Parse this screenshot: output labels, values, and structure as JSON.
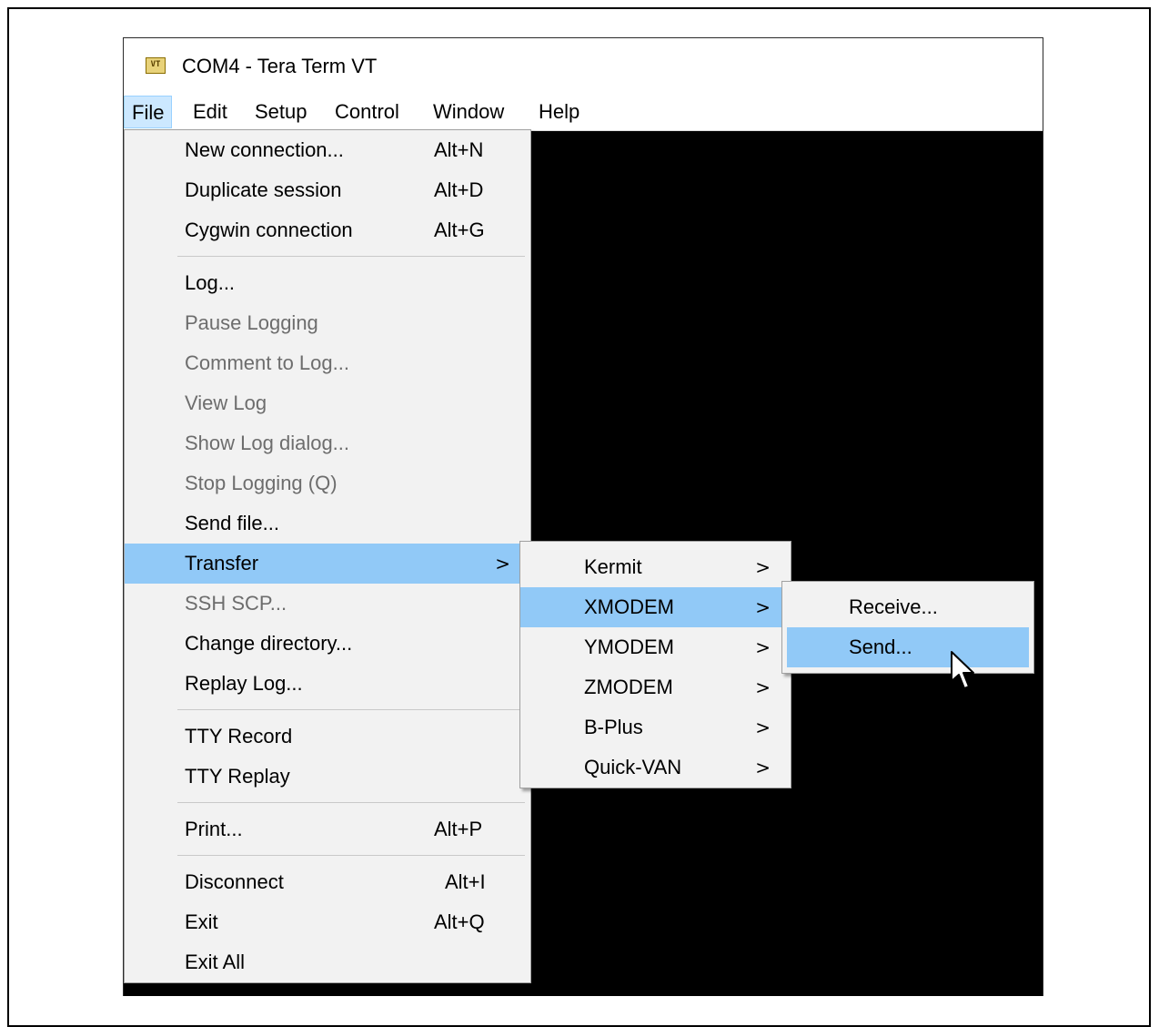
{
  "window": {
    "title": "COM4 - Tera Term VT",
    "icon": "tera-term-vt-icon",
    "icon_text": "VT"
  },
  "menubar": [
    "File",
    "Edit",
    "Setup",
    "Control",
    "Window",
    "Help"
  ],
  "file_menu": {
    "new_connection": {
      "label": "New connection...",
      "shortcut": "Alt+N"
    },
    "duplicate_session": {
      "label": "Duplicate session",
      "shortcut": "Alt+D"
    },
    "cygwin_connection": {
      "label": "Cygwin connection",
      "shortcut": "Alt+G"
    },
    "log": {
      "label": "Log..."
    },
    "pause_logging": {
      "label": "Pause Logging"
    },
    "comment_to_log": {
      "label": "Comment to Log..."
    },
    "view_log": {
      "label": "View Log"
    },
    "show_log_dialog": {
      "label": "Show Log dialog..."
    },
    "stop_logging": {
      "label": "Stop Logging (Q)"
    },
    "send_file": {
      "label": "Send file..."
    },
    "transfer": {
      "label": "Transfer",
      "arrow": ">"
    },
    "ssh_scp": {
      "label": "SSH SCP..."
    },
    "change_directory": {
      "label": "Change directory..."
    },
    "replay_log": {
      "label": "Replay Log..."
    },
    "tty_record": {
      "label": "TTY Record"
    },
    "tty_replay": {
      "label": "TTY Replay"
    },
    "print": {
      "label": "Print...",
      "shortcut": "Alt+P"
    },
    "disconnect": {
      "label": "Disconnect",
      "shortcut": "Alt+I"
    },
    "exit": {
      "label": "Exit",
      "shortcut": "Alt+Q"
    },
    "exit_all": {
      "label": "Exit All"
    }
  },
  "transfer_menu": [
    {
      "label": "Kermit",
      "arrow": ">"
    },
    {
      "label": "XMODEM",
      "arrow": ">"
    },
    {
      "label": "YMODEM",
      "arrow": ">"
    },
    {
      "label": "ZMODEM",
      "arrow": ">"
    },
    {
      "label": "B-Plus",
      "arrow": ">"
    },
    {
      "label": "Quick-VAN",
      "arrow": ">"
    }
  ],
  "xmodem_menu": [
    {
      "label": "Receive..."
    },
    {
      "label": "Send..."
    }
  ],
  "colors": {
    "highlight": "#91c9f7",
    "menu_bg": "#f2f2f2",
    "terminal_bg": "#000000",
    "disabled_text": "#6d6d6d"
  }
}
